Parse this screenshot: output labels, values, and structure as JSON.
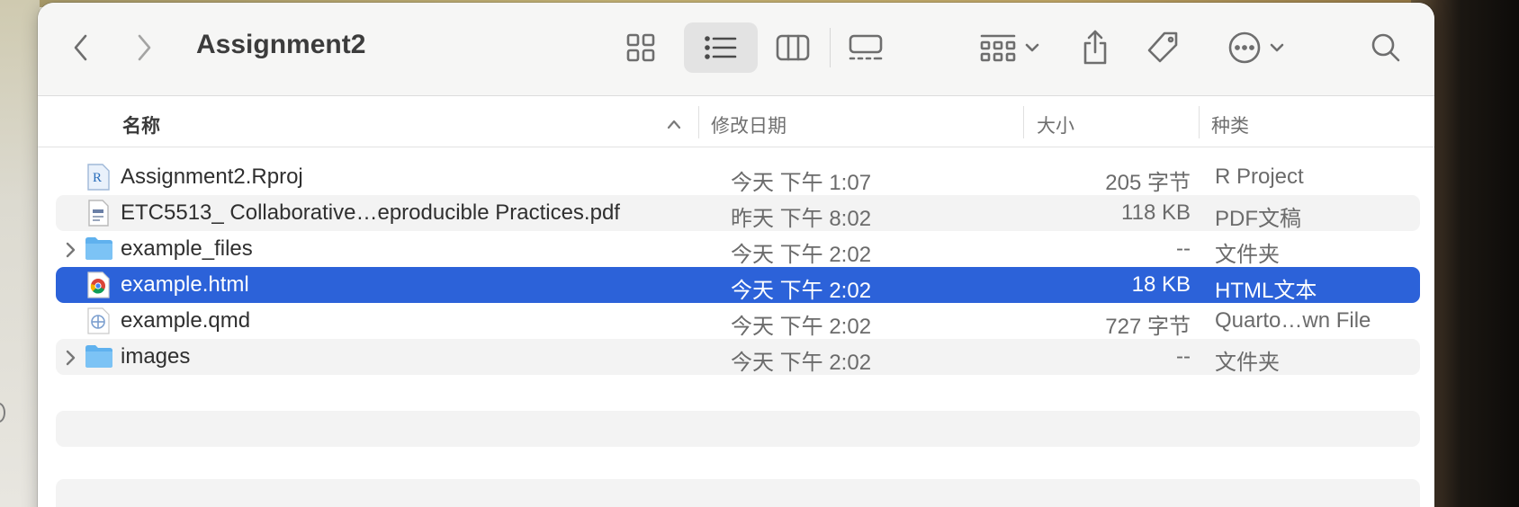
{
  "window": {
    "title": "Assignment2"
  },
  "toolbar": {
    "back_icon": "chevron-left-icon",
    "forward_icon": "chevron-right-icon",
    "view_modes": [
      "icon-view",
      "list-view",
      "column-view",
      "gallery-view"
    ],
    "active_view": "list-view"
  },
  "columns": {
    "name": "名称",
    "date": "修改日期",
    "size": "大小",
    "kind": "种类"
  },
  "files": [
    {
      "name": "Assignment2.Rproj",
      "date": "今天 下午 1:07",
      "size": "205 字节",
      "kind": "R Project",
      "icon": "rproj-file-icon",
      "folder": false
    },
    {
      "name": "ETC5513_ Collaborative…eproducible Practices.pdf",
      "date": "昨天 下午 8:02",
      "size": "118 KB",
      "kind": "PDF文稿",
      "icon": "pdf-file-icon",
      "folder": false
    },
    {
      "name": "example_files",
      "date": "今天 下午 2:02",
      "size": "--",
      "kind": "文件夹",
      "icon": "folder-icon",
      "folder": true
    },
    {
      "name": "example.html",
      "date": "今天 下午 2:02",
      "size": "18 KB",
      "kind": "HTML文本",
      "icon": "chrome-html-file-icon",
      "folder": false,
      "selected": true
    },
    {
      "name": "example.qmd",
      "date": "今天 下午 2:02",
      "size": "727 字节",
      "kind": "Quarto…wn File",
      "icon": "quarto-file-icon",
      "folder": false
    },
    {
      "name": "images",
      "date": "今天 下午 2:02",
      "size": "--",
      "kind": "文件夹",
      "icon": "folder-icon",
      "folder": true
    }
  ],
  "colors": {
    "selection": "#2c62d9",
    "toolbar_bg": "#f6f6f5",
    "stripe": "#f3f3f3",
    "folder": "#5fb1ee"
  }
}
